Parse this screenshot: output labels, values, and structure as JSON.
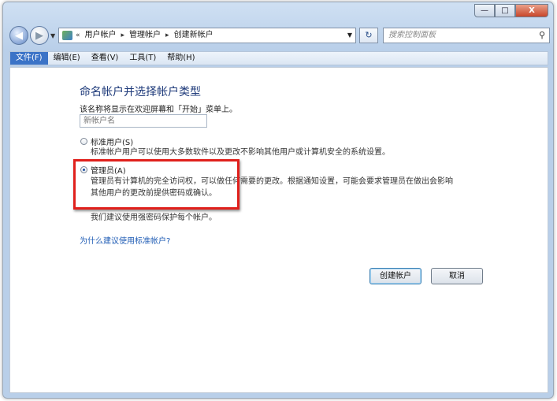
{
  "window": {
    "controls": [
      "—",
      "□",
      "X"
    ]
  },
  "nav": {
    "breadcrumb": [
      "«",
      "用户帐户",
      "管理帐户",
      "创建新帐户"
    ],
    "search_placeholder": "搜索控制面板",
    "icons": {
      "back": "back-arrow-icon",
      "forward": "forward-arrow-icon",
      "refresh": "refresh-icon",
      "search": "magnifier-icon",
      "location": "control-panel-icon"
    }
  },
  "menu": [
    "文件(F)",
    "编辑(E)",
    "查看(V)",
    "工具(T)",
    "帮助(H)"
  ],
  "page": {
    "title": "命名帐户并选择帐户类型",
    "hint": "该名称将显示在欢迎屏幕和「开始」菜单上。",
    "name_placeholder": "新帐户名",
    "options": [
      {
        "label": "标准用户(S)",
        "checked": false,
        "description": [
          "标准帐户用户可以使用大多数软件以及更改不影响其他用户或计算机安全的系统设置。"
        ]
      },
      {
        "label": "管理员(A)",
        "checked": true,
        "description": [
          "管理员有计算机的完全访问权，可以做任何需要的更改。根据通知设置，可能会要求管理员在做出会影响",
          "其他用户的更改前提供密码或确认。"
        ]
      }
    ],
    "recommend": "我们建议使用强密码保护每个帐户。",
    "link": "为什么建议使用标准帐户?",
    "buttons": {
      "create": "创建帐户",
      "cancel": "取消"
    }
  },
  "colors": {
    "highlight": "#e0201c",
    "link": "#1f5cb5",
    "title": "#1e3a7a",
    "menu_active": "#3b73c7"
  }
}
